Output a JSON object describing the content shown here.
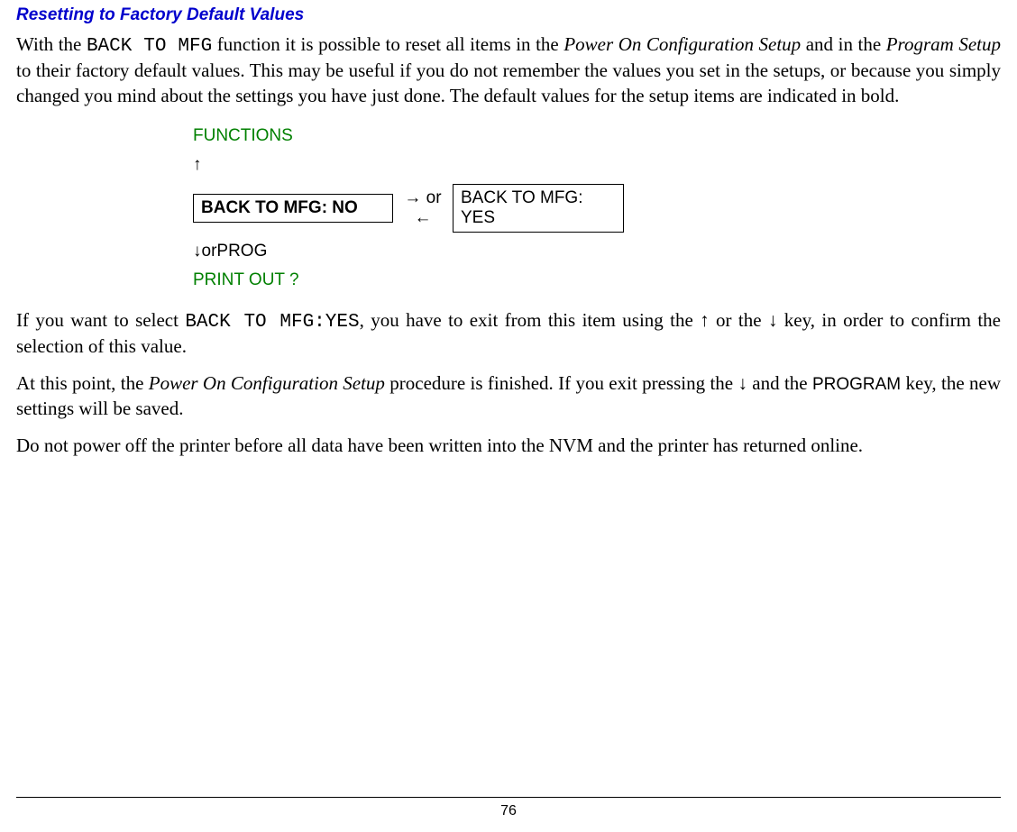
{
  "heading": "Resetting to Factory Default Values",
  "para1_pre": "With the ",
  "para1_mono": "BACK TO MFG",
  "para1_a": " function it is possible to reset all items in the ",
  "para1_i1": "Power On Configuration Setup",
  "para1_b": " and in the ",
  "para1_i2": "Program Setup",
  "para1_c": " to their factory default values. This may be useful if you do not remember the values you set in the setups, or because you simply changed you mind about the settings you have just done. The default values  for the setup items are indicated in bold.",
  "diagram": {
    "functions": "FUNCTIONS",
    "up_arrow": "↑",
    "box_no": "BACK TO MFG: NO",
    "or_arrows": "→ or ←",
    "box_yes": "BACK TO MFG: YES",
    "down_or_prog_arrow": "↓",
    "down_or_prog_or": " or ",
    "down_or_prog_prog": "PROG",
    "printout": "PRINT OUT ?"
  },
  "para2_a": "If you want to select ",
  "para2_mono": "BACK TO MFG:YES",
  "para2_b": ", you have to exit from this item using the ",
  "para2_up": "↑",
  "para2_c": " or the ",
  "para2_down": "↓",
  "para2_d": " key, in order to confirm the selection of this value.",
  "para3_a": "At this point, the ",
  "para3_i": "Power On Configuration Setup",
  "para3_b": " procedure is finished. If you exit pressing the ",
  "para3_down": "↓",
  "para3_c": " and the ",
  "para3_prog": "PROGRAM",
  "para3_d": " key, the new settings will be saved.",
  "para4": "Do not power off the printer before all data have been written into the NVM and the printer has returned online.",
  "page_number": "76"
}
